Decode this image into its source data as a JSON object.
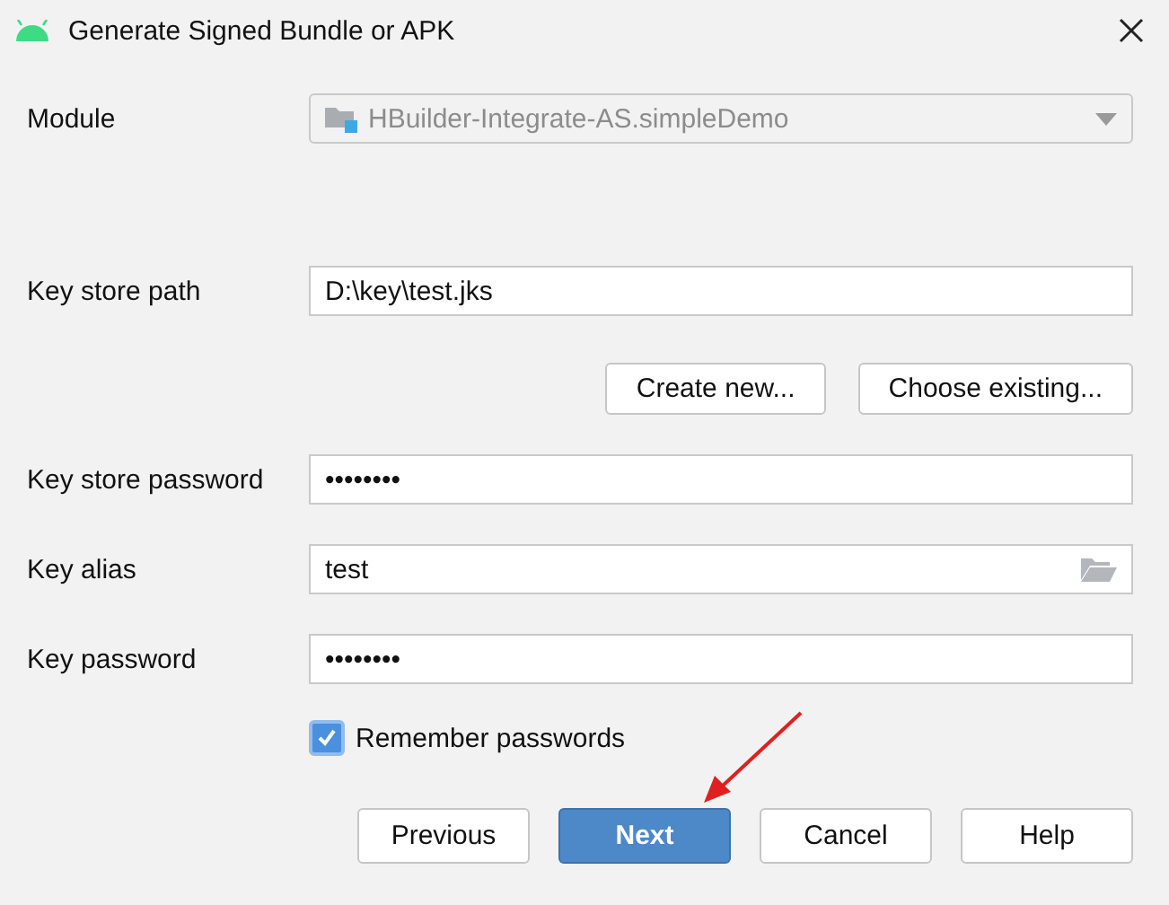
{
  "window": {
    "title": "Generate Signed Bundle or APK"
  },
  "module": {
    "label": "Module",
    "value": "HBuilder-Integrate-AS.simpleDemo",
    "disabled": true
  },
  "key_store_path": {
    "label": "Key store path",
    "value": "D:\\key\\test.jks"
  },
  "key_store_buttons": [
    "Create new...",
    "Choose existing..."
  ],
  "fields": [
    {
      "label": "Key store password",
      "value": "••••••••",
      "browse": false
    },
    {
      "label": "Key alias",
      "value": "test",
      "browse": true
    },
    {
      "label": "Key password",
      "value": "••••••••",
      "browse": false
    }
  ],
  "remember": {
    "label": "Remember passwords",
    "checked": true
  },
  "buttons": [
    {
      "label": "Previous",
      "primary": false
    },
    {
      "label": "Next",
      "primary": true
    },
    {
      "label": "Cancel",
      "primary": false
    },
    {
      "label": "Help",
      "primary": false
    }
  ]
}
